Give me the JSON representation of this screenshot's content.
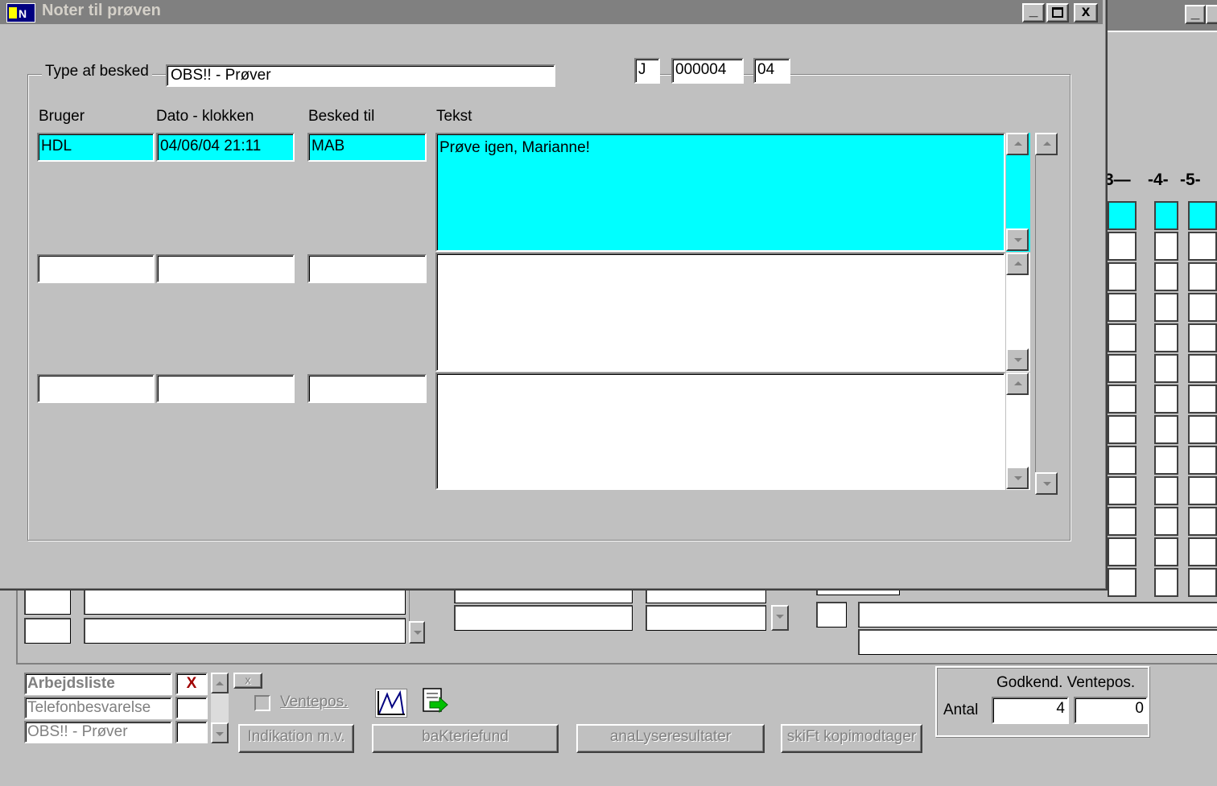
{
  "dialog": {
    "title": "Noter til prøven",
    "type_label": "Type af besked",
    "type_value": "OBS!! - Prøver",
    "code1": "J",
    "code2": "000004",
    "code3": "04",
    "columns": {
      "user": "Bruger",
      "datetime": "Dato - klokken",
      "to": "Besked til",
      "text": "Tekst"
    },
    "rows": [
      {
        "user": "HDL",
        "datetime": "04/06/04 21:11",
        "to": "MAB",
        "text": "Prøve igen, Marianne!"
      },
      {
        "user": "",
        "datetime": "",
        "to": "",
        "text": ""
      },
      {
        "user": "",
        "datetime": "",
        "to": "",
        "text": ""
      }
    ]
  },
  "background": {
    "col_header_3": "3—",
    "col_header_4": "-4-",
    "col_header_5": "-5-",
    "list": {
      "items": [
        "Arbejdsliste",
        "Telefonbesvarelse",
        "OBS!! - Prøver"
      ],
      "mark": "X",
      "x_button": "x"
    },
    "ventepos_label": "Ventepos.",
    "buttons": {
      "indikation": "Indikation m.v.",
      "bakteriefund": "baKteriefund",
      "analyseresultater": "anaLyseresultater",
      "skift": "skiFt kopimodtager"
    },
    "summary": {
      "header": "Godkend. Ventepos.",
      "antal_label": "Antal",
      "godkend_value": "4",
      "ventepos_value": "0"
    }
  },
  "colors": {
    "selected": "#00ffff",
    "title_inactive": "#808080"
  }
}
